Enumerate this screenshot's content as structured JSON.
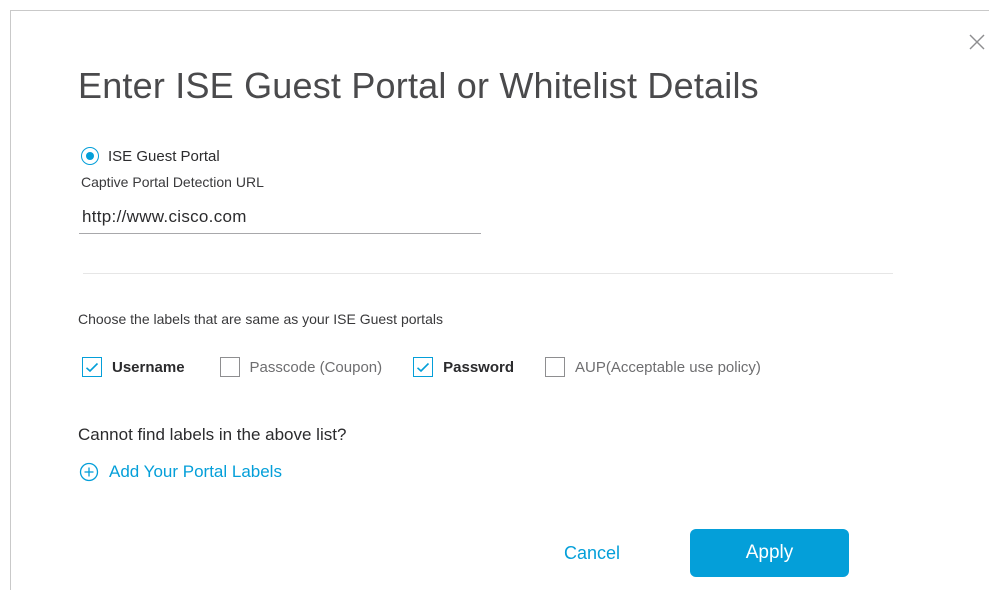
{
  "dialog": {
    "title": "Enter ISE Guest Portal or Whitelist Details",
    "close_icon": "close-icon"
  },
  "portal": {
    "radio_label": "ISE Guest Portal",
    "radio_selected": true,
    "url_label": "Captive Portal Detection URL",
    "url_value": "http://www.cisco.com"
  },
  "labels_section": {
    "instruction": "Choose the labels that are same as your ISE Guest portals",
    "options": [
      {
        "label": "Username",
        "checked": true
      },
      {
        "label": "Passcode (Coupon)",
        "checked": false
      },
      {
        "label": "Password",
        "checked": true
      },
      {
        "label": "AUP(Acceptable use policy)",
        "checked": false
      }
    ]
  },
  "custom_labels": {
    "question": "Cannot find labels in the above list?",
    "add_link": "Add Your Portal Labels",
    "add_icon": "plus-circle-icon"
  },
  "actions": {
    "cancel_label": "Cancel",
    "apply_label": "Apply"
  },
  "colors": {
    "accent": "#049fd9",
    "text": "#39393b",
    "border": "#c9c9c9"
  }
}
